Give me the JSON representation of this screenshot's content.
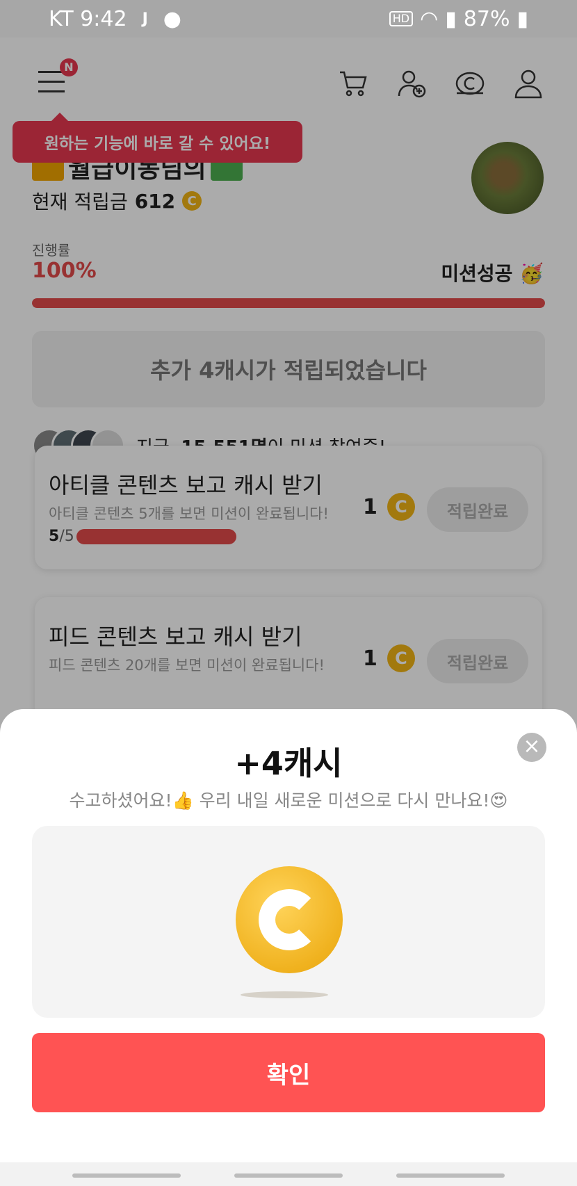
{
  "status_bar": {
    "carrier_time": "KT 9:42",
    "indicator_j": "J",
    "hd": "HD",
    "battery": "87%"
  },
  "nav": {
    "badge": "N",
    "tooltip": "원하는 기능에 바로 갈 수 있어요!"
  },
  "profile": {
    "name_text": "월급이동님의",
    "balance_label": "현재 적립금",
    "balance_value": "612",
    "coin_symbol": "C"
  },
  "progress": {
    "label": "진행률",
    "value": "100%",
    "fill_percent": 100,
    "status": "미션성공 🥳"
  },
  "extra_reward": "추가 4캐시가 적립되었습니다",
  "participants": {
    "prefix": "지금, ",
    "count": "15,551명",
    "suffix": "이 미션 참여중!"
  },
  "missions": [
    {
      "title": "아티클 콘텐츠 보고 캐시 받기",
      "desc": "아티클 콘텐츠 5개를 보면 미션이 완료됩니다!",
      "count_done": "5",
      "count_total": "/5",
      "reward": "1",
      "button": "적립완료"
    },
    {
      "title": "피드 콘텐츠 보고 캐시 받기",
      "desc": "피드 콘텐츠 20개를 보면 미션이 완료됩니다!",
      "reward": "1",
      "button": "적립완료"
    }
  ],
  "sheet": {
    "title": "+4캐시",
    "subtitle": "수고하셨어요!👍 우리 내일 새로운 미션으로 다시 만나요!😍",
    "confirm": "확인",
    "close": "×"
  },
  "colors": {
    "accent": "#ff5353",
    "progress": "#e34b4b",
    "coin": "#f2b516"
  }
}
